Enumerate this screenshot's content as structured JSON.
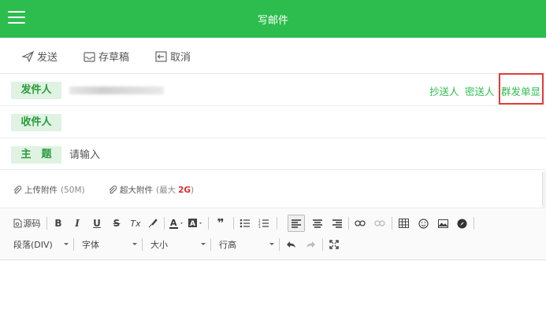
{
  "header": {
    "title": "写邮件",
    "menu_icon": "hamburger-icon"
  },
  "actions": [
    {
      "label": "发送",
      "icon": "send-icon"
    },
    {
      "label": "存草稿",
      "icon": "draft-icon"
    },
    {
      "label": "取消",
      "icon": "cancel-icon"
    }
  ],
  "sender": {
    "label": "发件人"
  },
  "recipient": {
    "label": "收件人"
  },
  "links": {
    "cc": "抄送人",
    "bcc": "密送人",
    "group_send": "群发单显"
  },
  "subject": {
    "label": "主　题",
    "placeholder": "请输入",
    "value": ""
  },
  "attachments": {
    "upload": {
      "label": "上传附件",
      "limit": "(50M)"
    },
    "large": {
      "label": "超大附件",
      "limit_prefix": "(最大",
      "limit_value": "2G",
      "limit_suffix": ")"
    }
  },
  "toolbar": {
    "source_label": "源码",
    "row1": [
      "B",
      "I",
      "U",
      "S",
      "Tx"
    ],
    "paragraph_format": "段落(DIV)",
    "font_family": "字体",
    "font_size": "大小",
    "line_height": "行高"
  },
  "colors": {
    "accent": "#2dbd4e",
    "tag_bg": "#dff3e2",
    "highlight": "#e53935"
  }
}
